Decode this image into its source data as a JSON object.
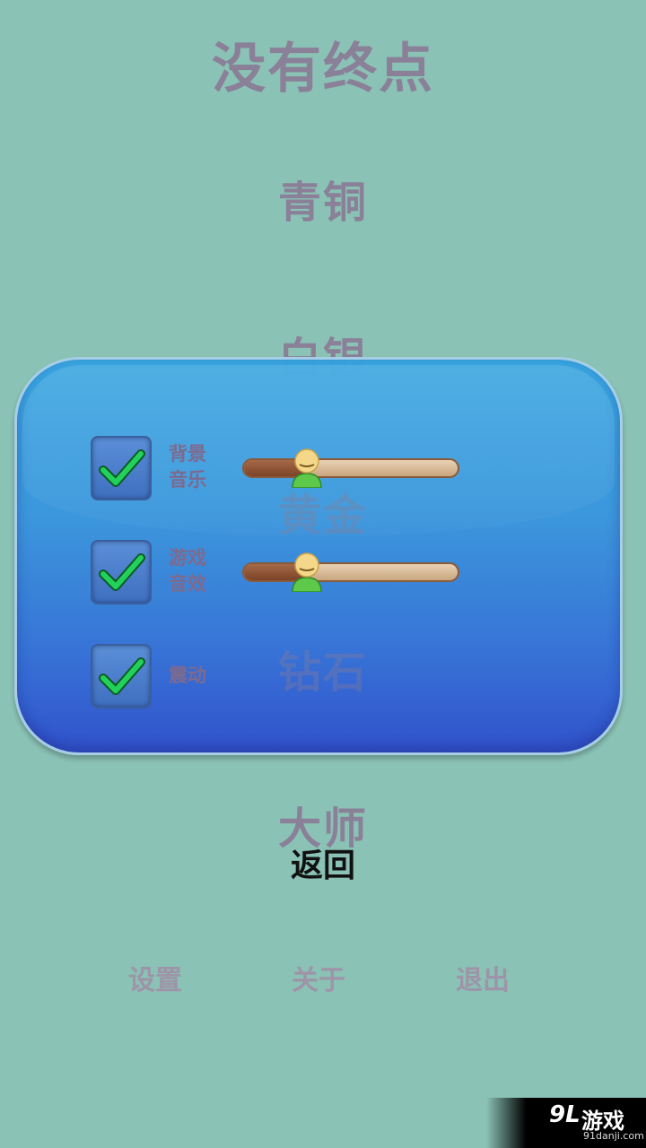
{
  "title": "没有终点",
  "levels": [
    "青铜",
    "白银",
    "黄金",
    "钻石",
    "大师"
  ],
  "settings": {
    "bgm": {
      "label_line1": "背景",
      "label_line2": "音乐",
      "checked": true,
      "volume": 0.3
    },
    "sfx": {
      "label_line1": "游戏",
      "label_line2": "音效",
      "checked": true,
      "volume": 0.3
    },
    "vibrate": {
      "label": "震动",
      "checked": true
    }
  },
  "back_label": "返回",
  "nav": {
    "settings": "设置",
    "about": "关于",
    "exit": "退出"
  },
  "watermark": {
    "logo": "9L",
    "text": "游戏",
    "url": "91danji.com"
  },
  "colors": {
    "background": "#8ac2b5",
    "check": "#22d15a",
    "text_muted": "#8a8098"
  }
}
